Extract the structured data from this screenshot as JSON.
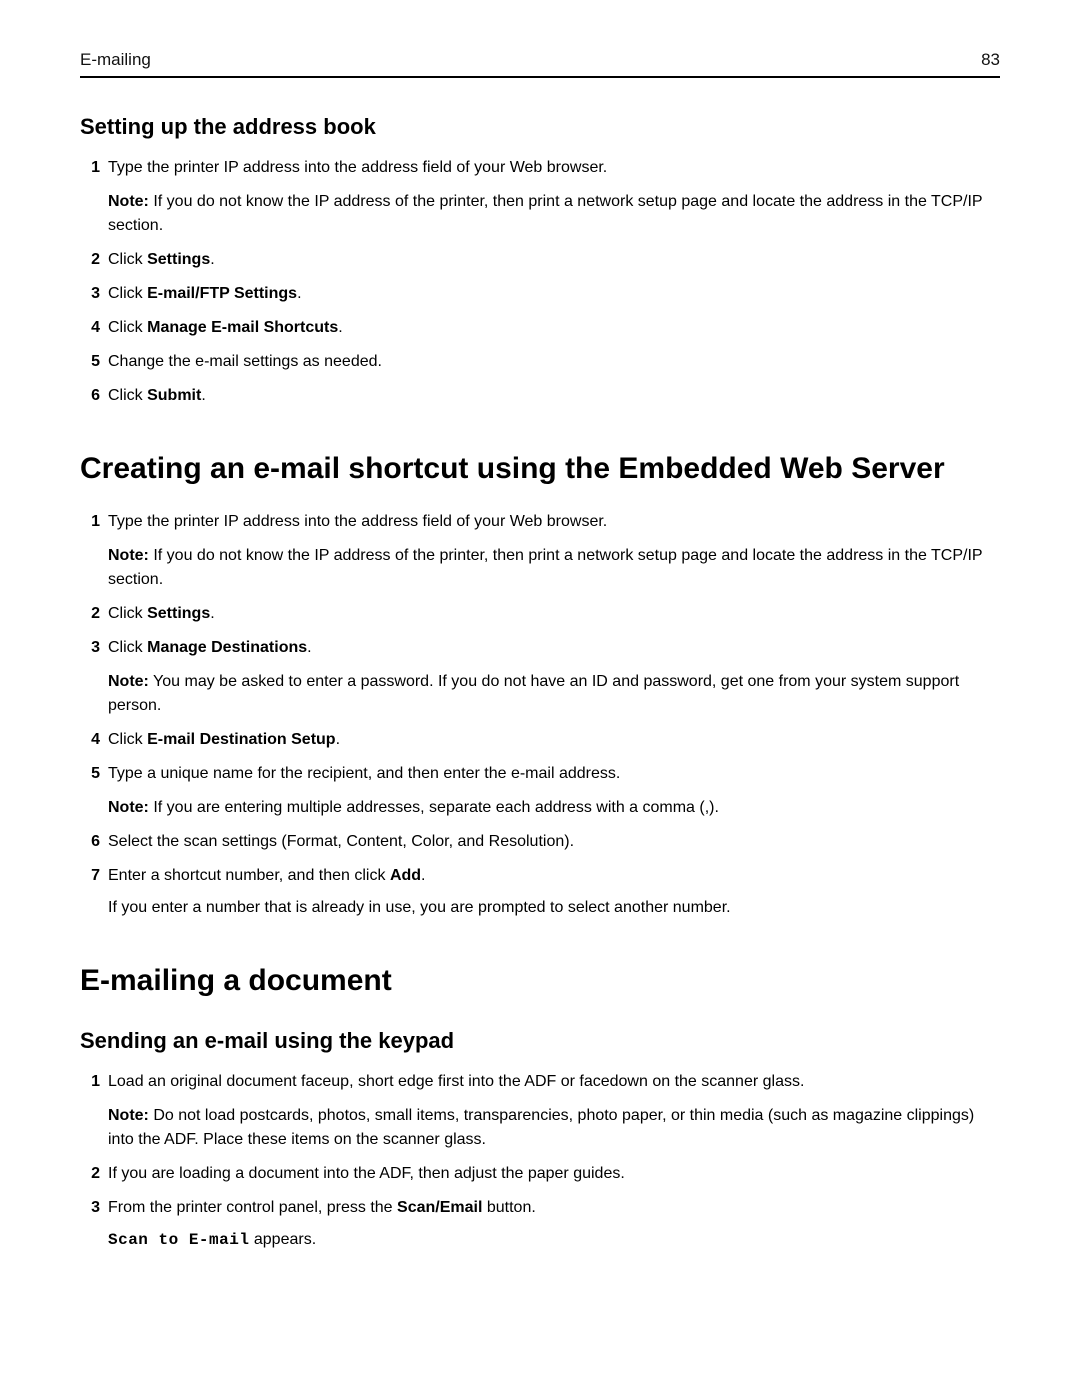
{
  "header": {
    "left": "E-mailing",
    "right": "83"
  },
  "sec1_title": "Setting up the address book",
  "sec1": {
    "s1": "Type the printer IP address into the address field of your Web browser.",
    "s1_note_label": "Note:",
    "s1_note": " If you do not know the IP address of the printer, then print a network setup page and locate the address in the TCP/IP section.",
    "s2_pre": "Click ",
    "s2_b": "Settings",
    "s2_post": ".",
    "s3_pre": "Click ",
    "s3_b": "E-mail/FTP Settings",
    "s3_post": ".",
    "s4_pre": "Click ",
    "s4_b": "Manage E-mail Shortcuts",
    "s4_post": ".",
    "s5": "Change the e-mail settings as needed.",
    "s6_pre": "Click ",
    "s6_b": "Submit",
    "s6_post": "."
  },
  "sec2_title": "Creating an e-mail shortcut using the Embedded Web Server",
  "sec2": {
    "s1": "Type the printer IP address into the address field of your Web browser.",
    "s1_note_label": "Note:",
    "s1_note": " If you do not know the IP address of the printer, then print a network setup page and locate the address in the TCP/IP section.",
    "s2_pre": "Click ",
    "s2_b": "Settings",
    "s2_post": ".",
    "s3_pre": "Click ",
    "s3_b": "Manage Destinations",
    "s3_post": ".",
    "s3_note_label": "Note:",
    "s3_note": " You may be asked to enter a password. If you do not have an ID and password, get one from your system support person.",
    "s4_pre": "Click ",
    "s4_b": "E-mail Destination Setup",
    "s4_post": ".",
    "s5": "Type a unique name for the recipient, and then enter the e-mail address.",
    "s5_note_label": "Note:",
    "s5_note": " If you are entering multiple addresses, separate each address with a comma (,).",
    "s6": "Select the scan settings (Format, Content, Color, and Resolution).",
    "s7_pre": "Enter a shortcut number, and then click ",
    "s7_b": "Add",
    "s7_post": ".",
    "s7_after": "If you enter a number that is already in use, you are prompted to select another number."
  },
  "sec3_title": "E-mailing a document",
  "sec3_sub_title": "Sending an e-mail using the keypad",
  "sec3": {
    "s1": "Load an original document faceup, short edge first into the ADF or facedown on the scanner glass.",
    "s1_note_label": "Note:",
    "s1_note": " Do not load postcards, photos, small items, transparencies, photo paper, or thin media (such as magazine clippings) into the ADF. Place these items on the scanner glass.",
    "s2": "If you are loading a document into the ADF, then adjust the paper guides.",
    "s3_pre": "From the printer control panel, press the ",
    "s3_b": "Scan/Email",
    "s3_post": " button.",
    "s3_mono": "Scan to E-mail",
    "s3_tail": " appears."
  }
}
